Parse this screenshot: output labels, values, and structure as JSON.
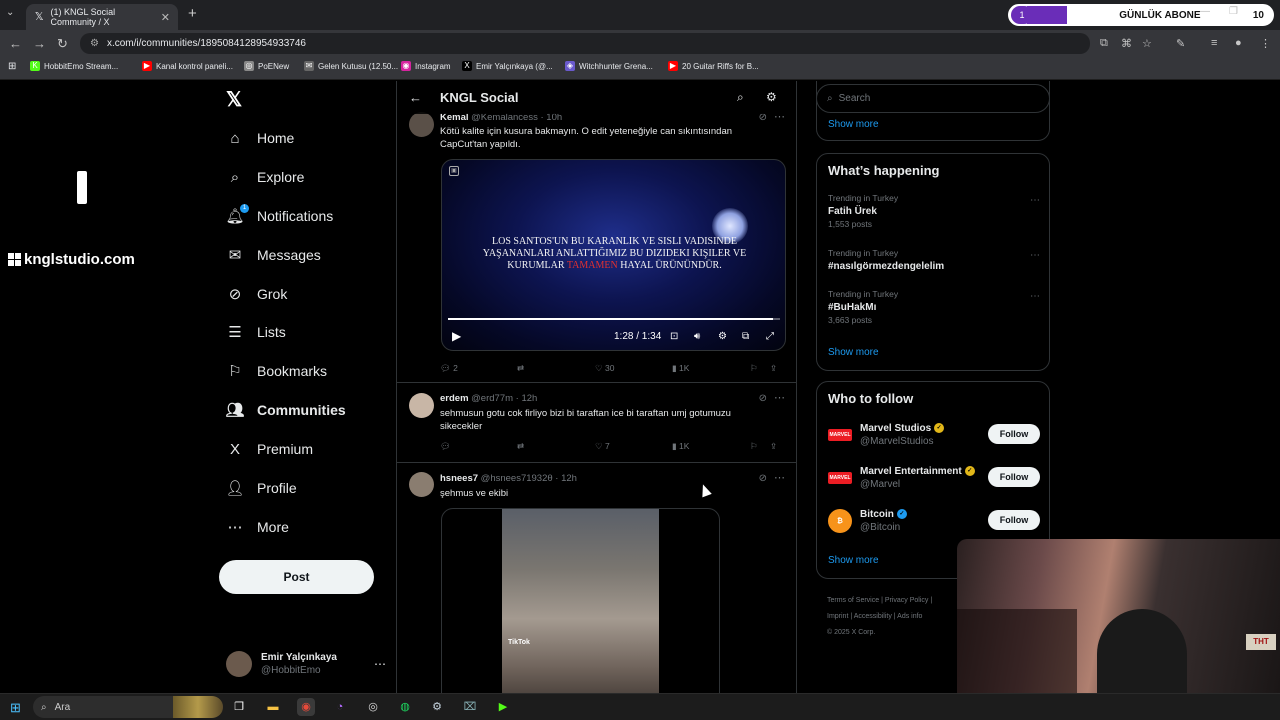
{
  "browser": {
    "tab_title": "(1) KNGL Social Community / X",
    "tab_close": "✕",
    "new_tab": "+",
    "url": "x.com/i/communities/1895084128954933746",
    "bookmarks": [
      {
        "label": "HobbitEmo Stream...",
        "icon": "K",
        "color": "#53fc18"
      },
      {
        "label": "Kanal kontrol paneli...",
        "icon": "▶",
        "color": "#ff0000"
      },
      {
        "label": "PoENew",
        "icon": "◎",
        "color": "#888888"
      },
      {
        "label": "Gelen Kutusu (12.50...",
        "icon": "✉",
        "color": "#666666"
      },
      {
        "label": "Instagram",
        "icon": "◉",
        "color": "#d6249f"
      },
      {
        "label": "Emir Yalçınkaya (@...",
        "icon": "X",
        "color": "#000000"
      },
      {
        "label": "Witchhunter Grena...",
        "icon": "◈",
        "color": "#6a5acd"
      },
      {
        "label": "20 Guitar Riffs for B...",
        "icon": "▶",
        "color": "#ff0000"
      }
    ]
  },
  "subscriber_widget": {
    "level": "1",
    "label": "GÜNLÜK ABONE",
    "count": "10"
  },
  "overlay": {
    "brand": "knglstudio.com"
  },
  "nav": {
    "items": [
      {
        "label": "Home",
        "icon": "⌂"
      },
      {
        "label": "Explore",
        "icon": "⌕"
      },
      {
        "label": "Notifications",
        "icon": "🔔︎",
        "badge": "1"
      },
      {
        "label": "Messages",
        "icon": "✉"
      },
      {
        "label": "Grok",
        "icon": "⊘"
      },
      {
        "label": "Lists",
        "icon": "☰"
      },
      {
        "label": "Bookmarks",
        "icon": "⚐"
      },
      {
        "label": "Communities",
        "icon": "👥︎"
      },
      {
        "label": "Premium",
        "icon": "X"
      },
      {
        "label": "Profile",
        "icon": "👤︎"
      },
      {
        "label": "More",
        "icon": "⋯"
      }
    ],
    "post_label": "Post",
    "account": {
      "name": "Emir Yalçınkaya",
      "handle": "@HobbitEmo"
    }
  },
  "community": {
    "title": "KNGL Social"
  },
  "tweets": [
    {
      "name": "Kemal",
      "handle": "@Kemalancess",
      "time": "10h",
      "text": "Kötü kalite için kusura bakmayın. O edit yeteneğiyle can sıkıntısından CapCut'tan yapıldı.",
      "video": {
        "caption_1": "Los Santos'un bu karanlık ve sisli vadisinde yaşananları anlattığımız bu dizideki kişiler ve kurumlar",
        "caption_red": "tamamen",
        "caption_2": "hayal ürünündür.",
        "time": "1:28 / 1:34",
        "progress": 0.98
      },
      "replies": "2",
      "reposts": "",
      "likes": "30",
      "views": "1K"
    },
    {
      "name": "erdem",
      "handle": "@erd77m",
      "time": "12h",
      "text": "sehmusun gotu cok firliyo bizi bi taraftan ice bi taraftan umj gotumuzu sikecekler",
      "replies": "",
      "reposts": "",
      "likes": "7",
      "views": "1K"
    },
    {
      "name": "hsnees7",
      "handle": "@hsnees71932θ",
      "time": "12h",
      "text": "şehmus ve ekibi",
      "media_label": "TikTok"
    }
  ],
  "sidebar": {
    "search_placeholder": "Search",
    "top_show_more": "Show more",
    "happening_title": "What’s happening",
    "trends": [
      {
        "context": "Trending in Turkey",
        "name": "Fatih Ürek",
        "posts": "1,553 posts"
      },
      {
        "context": "Trending in Turkey",
        "name": "#nasılgörmezdengelelim",
        "posts": ""
      },
      {
        "context": "Trending in Turkey",
        "name": "#BuHakMı",
        "posts": "3,663 posts"
      }
    ],
    "happening_show_more": "Show more",
    "wtf_title": "Who to follow",
    "who_to_follow": [
      {
        "name": "Marvel Studios",
        "handle": "@MarvelStudios",
        "logo": "MARVEL",
        "logo_color": "#ec1d24",
        "verified": "gold"
      },
      {
        "name": "Marvel Entertainment",
        "handle": "@Marvel",
        "logo": "MARVEL",
        "logo_color": "#ec1d24",
        "verified": "gold"
      },
      {
        "name": "Bitcoin",
        "handle": "@Bitcoin",
        "logo": "₿",
        "logo_color": "#f7931a",
        "verified": "blue"
      }
    ],
    "follow_label": "Follow",
    "wtf_show_more": "Show more",
    "footer_1": "Terms of Service  |  Privacy Policy  |",
    "footer_2": "Imprint  |  Accessibility  |  Ads info",
    "footer_3": "© 2025 X Corp."
  },
  "taskbar": {
    "search": "Ara"
  },
  "colors": {
    "accent": "#1d9bf0",
    "border": "#2f3336",
    "muted": "#71767b"
  }
}
